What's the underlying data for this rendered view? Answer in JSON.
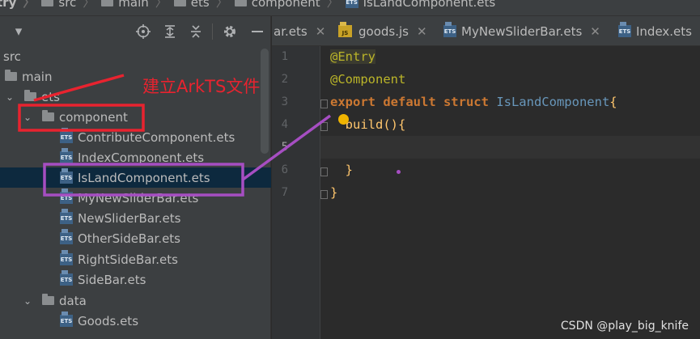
{
  "breadcrumb": {
    "items": [
      {
        "label": "try",
        "icon": "folder-icon"
      },
      {
        "label": "src",
        "icon": "folder-icon"
      },
      {
        "label": "main",
        "icon": "folder-icon"
      },
      {
        "label": "ets",
        "icon": "folder-icon"
      },
      {
        "label": "component",
        "icon": "folder-icon"
      },
      {
        "label": "IsLandComponent.ets",
        "icon": "ets-file-icon"
      }
    ]
  },
  "project_toolbar": {
    "dropdown_icon": "▾",
    "icons": [
      "locate-icon",
      "expand-all-icon",
      "collapse-all-icon",
      "gear-icon",
      "hide-icon"
    ]
  },
  "tree": {
    "rows": [
      {
        "label": "src",
        "kind": "folder",
        "expanded": false
      },
      {
        "label": "main",
        "kind": "folder",
        "expanded": false
      },
      {
        "label": "ets",
        "kind": "folder",
        "expanded": true
      },
      {
        "label": "component",
        "kind": "folder",
        "expanded": true
      },
      {
        "label": "ContributeComponent.ets",
        "kind": "file"
      },
      {
        "label": "IndexComponent.ets",
        "kind": "file"
      },
      {
        "label": "IsLandComponent.ets",
        "kind": "file",
        "selected": true
      },
      {
        "label": "MyNewSliderBar.ets",
        "kind": "file"
      },
      {
        "label": "NewSliderBar.ets",
        "kind": "file"
      },
      {
        "label": "OtherSideBar.ets",
        "kind": "file"
      },
      {
        "label": "RightSideBar.ets",
        "kind": "file"
      },
      {
        "label": "SideBar.ets",
        "kind": "file"
      },
      {
        "label": "data",
        "kind": "folder",
        "expanded": true
      },
      {
        "label": "Goods.ets",
        "kind": "file"
      }
    ]
  },
  "tabs": [
    {
      "label": "ar.ets",
      "icon": "none",
      "close": "✕"
    },
    {
      "label": "goods.js",
      "icon": "js-file-icon",
      "close": "✕"
    },
    {
      "label": "MyNewSliderBar.ets",
      "icon": "ets-file-icon",
      "close": "✕"
    },
    {
      "label": "Index.ets",
      "icon": "ets-file-icon",
      "close": ""
    }
  ],
  "editor": {
    "line_numbers": [
      "1",
      "2",
      "3",
      "4",
      "5",
      "6",
      "7"
    ],
    "current_line": "5",
    "code": {
      "l1_anno": "@Entry",
      "l2_anno": "@Component",
      "l3_kw": "export default struct ",
      "l3_cls": "IsLandComponent",
      "l3_brace": "{",
      "l4_fn": "build",
      "l4_rest": "(){",
      "l6": "}",
      "l7": "}"
    }
  },
  "annotations": {
    "caption": "建立ArkTS文件",
    "red_color": "#e8232f",
    "purple_color": "#a64ec2"
  },
  "watermark": "CSDN @play_big_knife",
  "colors": {
    "panel_bg": "#3c3f41",
    "editor_bg": "#2b2b2b",
    "selected_row": "#0d293e",
    "keyword": "#cc7832",
    "annotation": "#bbb529",
    "class_name": "#6897bb",
    "function": "#ffc66d"
  }
}
